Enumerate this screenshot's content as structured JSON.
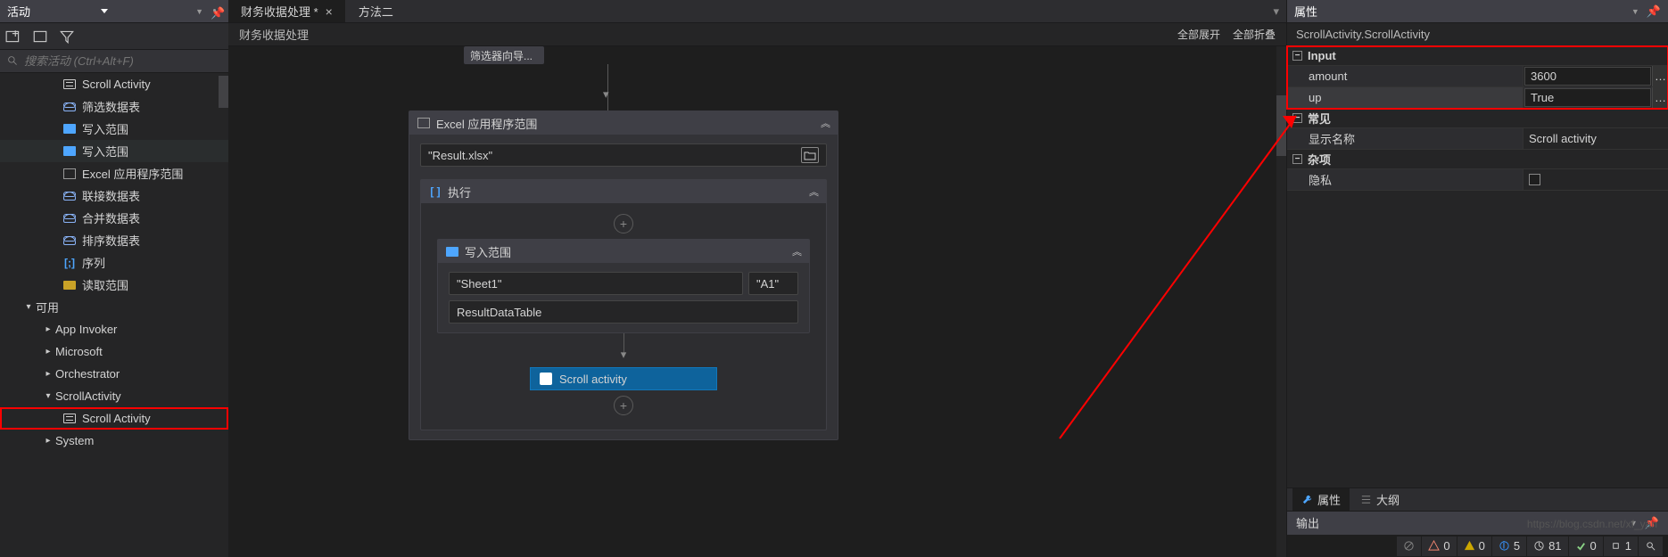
{
  "left": {
    "title": "活动",
    "search_placeholder": "搜索活动 (Ctrl+Alt+F)",
    "tree": [
      {
        "label": "Scroll Activity",
        "indent": 3,
        "icon": "scroll"
      },
      {
        "label": "筛选数据表",
        "indent": 3,
        "icon": "db"
      },
      {
        "label": "写入范围",
        "indent": 3,
        "icon": "sheet"
      },
      {
        "label": "写入范围",
        "indent": 3,
        "icon": "sheet",
        "highlighted": true
      },
      {
        "label": "Excel 应用程序范围",
        "indent": 3,
        "icon": "excel"
      },
      {
        "label": "联接数据表",
        "indent": 3,
        "icon": "db"
      },
      {
        "label": "合并数据表",
        "indent": 3,
        "icon": "db"
      },
      {
        "label": "排序数据表",
        "indent": 3,
        "icon": "db"
      },
      {
        "label": "序列",
        "indent": 3,
        "icon": "brackets"
      },
      {
        "label": "读取范围",
        "indent": 3,
        "icon": "read"
      },
      {
        "label": "可用",
        "indent": 1,
        "arrow": "▾"
      },
      {
        "label": "App Invoker",
        "indent": 2,
        "arrow": "▸"
      },
      {
        "label": "Microsoft",
        "indent": 2,
        "arrow": "▸"
      },
      {
        "label": "Orchestrator",
        "indent": 2,
        "arrow": "▸"
      },
      {
        "label": "ScrollActivity",
        "indent": 2,
        "arrow": "▾"
      },
      {
        "label": "Scroll Activity",
        "indent": 3,
        "icon": "scroll",
        "boxed": true
      },
      {
        "label": "System",
        "indent": 2,
        "arrow": "▸"
      }
    ]
  },
  "center": {
    "tabs": [
      {
        "label": "财务收据处理 *",
        "active": true
      },
      {
        "label": "方法二",
        "active": false
      }
    ],
    "breadcrumb": "财务收据处理",
    "actions": {
      "expand": "全部展开",
      "collapse": "全部折叠"
    },
    "filter_wizard": "筛选器向导...",
    "excel_scope": {
      "title": "Excel 应用程序范围",
      "file": "\"Result.xlsx\""
    },
    "execute": {
      "title": "执行"
    },
    "write_range": {
      "title": "写入范围",
      "sheet": "\"Sheet1\"",
      "cell": "\"A1\"",
      "datatable": "ResultDataTable"
    },
    "scroll_activity_label": "Scroll activity"
  },
  "right": {
    "title": "属性",
    "type": "ScrollActivity.ScrollActivity",
    "cats": {
      "input": "Input",
      "common": "常见",
      "misc": "杂项"
    },
    "props": {
      "amount_name": "amount",
      "amount_val": "3600",
      "up_name": "up",
      "up_val": "True",
      "display_name": "显示名称",
      "display_val": "Scroll activity",
      "privacy_name": "隐私"
    },
    "tabs": {
      "props": "属性",
      "outline": "大纲"
    },
    "output": "输出"
  },
  "status": {
    "err": "0",
    "warn": "0",
    "info": "5",
    "time": "81",
    "ok": "0",
    "dbg": "1"
  },
  "watermark": "https://blog.csdn.net/xf_yan"
}
